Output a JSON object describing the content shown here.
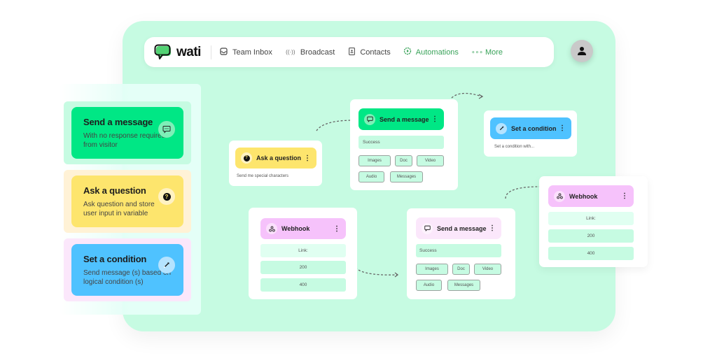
{
  "navbar": {
    "logo_text": "wati",
    "items": [
      {
        "label": "Team Inbox",
        "icon": "inbox-icon",
        "glyph": "⌂",
        "active": false
      },
      {
        "label": "Broadcast",
        "icon": "broadcast-icon",
        "glyph": "((·))",
        "active": false
      },
      {
        "label": "Contacts",
        "icon": "contacts-icon",
        "glyph": "▯",
        "active": false
      },
      {
        "label": "Automations",
        "icon": "automations-icon",
        "glyph": "⚙",
        "active": true
      },
      {
        "label": "More",
        "icon": "more-icon",
        "glyph": "∘∘∘",
        "active": false
      }
    ]
  },
  "avatar": {
    "icon": "user-icon"
  },
  "palette": {
    "items": [
      {
        "title": "Send a message",
        "desc": "With no response required from visitor",
        "icon": "chat-bubble-icon",
        "color": "#00e785",
        "wrap_color": "#c6fbe2"
      },
      {
        "title": "Ask a question",
        "desc": "Ask question and store user input in variable",
        "icon": "question-icon",
        "color": "#fde56d",
        "wrap_color": "#fff2d6"
      },
      {
        "title": "Set a condition",
        "desc": "Send message (s) based on logical condition (s)",
        "icon": "condition-icon",
        "color": "#4fc2ff",
        "wrap_color": "#fbe7fb"
      }
    ]
  },
  "flow": {
    "ask_question": {
      "title": "Ask a question",
      "sub": "Send me special characters"
    },
    "send_message_1": {
      "title": "Send a message",
      "success": "Success",
      "chips": [
        "Images",
        "Doc",
        "Video",
        "Audio",
        "Messages"
      ]
    },
    "set_condition": {
      "title": "Set a condition",
      "sub": "Set a condition with..."
    },
    "webhook_1": {
      "title": "Webhook",
      "rows": [
        "Link:",
        "200",
        "400"
      ]
    },
    "send_message_2": {
      "title": "Send a message",
      "success": "Success",
      "chips": [
        "Images",
        "Doc",
        "Video",
        "Audio",
        "Messages"
      ]
    },
    "webhook_2": {
      "title": "Webhook",
      "rows": [
        "Link:",
        "200",
        "400"
      ]
    }
  },
  "colors": {
    "canvas": "#c6fbe2",
    "green": "#00e785",
    "yellow": "#fde56d",
    "blue": "#4fc2ff",
    "pink": "#f6c2fb",
    "light_pink": "#fbe7fb",
    "accent_nav": "#3aa35a"
  }
}
